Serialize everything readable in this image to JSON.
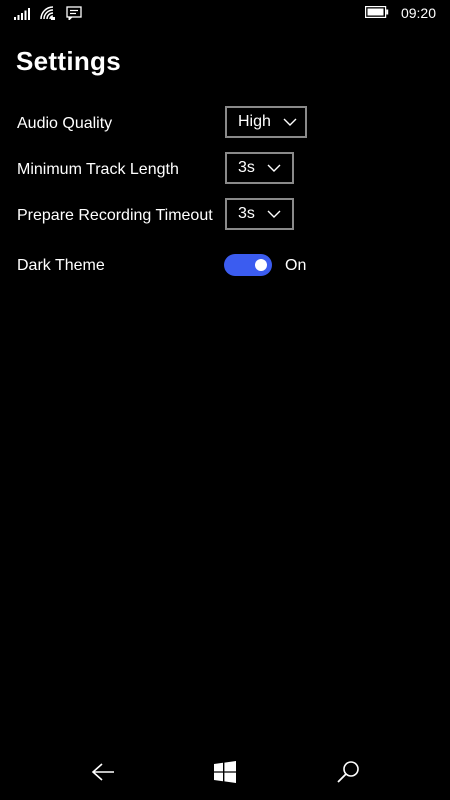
{
  "status_bar": {
    "time": "09:20",
    "icons": [
      "signal-icon",
      "wifi-icon",
      "message-icon",
      "battery-icon"
    ]
  },
  "page": {
    "title": "Settings"
  },
  "settings": {
    "audio_quality": {
      "label": "Audio Quality",
      "value": "High"
    },
    "min_track_length": {
      "label": "Minimum Track Length",
      "value": "3s"
    },
    "prepare_timeout": {
      "label": "Prepare Recording Timeout",
      "value": "3s"
    },
    "dark_theme": {
      "label": "Dark Theme",
      "state": "On",
      "enabled": true
    }
  },
  "nav_bar": {
    "icons": [
      "back-arrow-icon",
      "windows-icon",
      "search-icon"
    ]
  },
  "colors": {
    "background": "#000000",
    "accent": "#3b5cf0",
    "combo_border": "#8a8a8a"
  }
}
